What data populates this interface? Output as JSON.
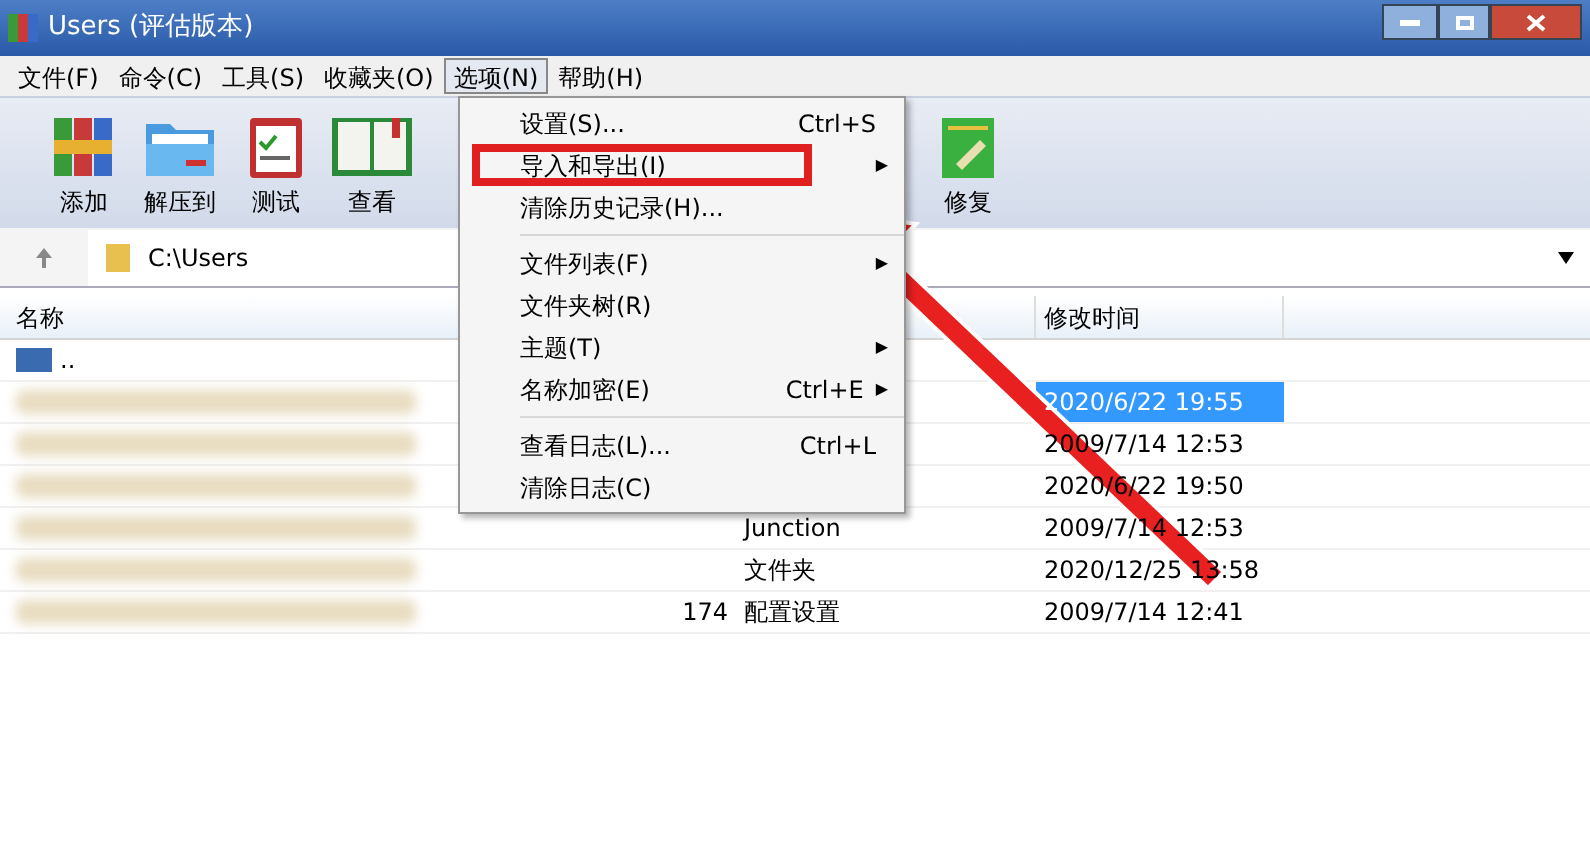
{
  "window": {
    "title": "Users (评估版本)"
  },
  "menubar": [
    {
      "label": "文件(F)",
      "selected": false
    },
    {
      "label": "命令(C)",
      "selected": false
    },
    {
      "label": "工具(S)",
      "selected": false
    },
    {
      "label": "收藏夹(O)",
      "selected": false
    },
    {
      "label": "选项(N)",
      "selected": true
    },
    {
      "label": "帮助(H)",
      "selected": false
    }
  ],
  "toolbar": [
    {
      "label": "添加",
      "kind": "add"
    },
    {
      "label": "解压到",
      "kind": "extract"
    },
    {
      "label": "测试",
      "kind": "test"
    },
    {
      "label": "查看",
      "kind": "view"
    },
    {
      "label": "修复",
      "kind": "repair"
    }
  ],
  "address": {
    "path": "C:\\Users"
  },
  "table": {
    "columns": [
      "名称",
      "修改时间"
    ],
    "rows": [
      {
        "name": "..",
        "selected": false
      },
      {
        "modified": "2020/6/22 19:55",
        "selected": true
      },
      {
        "modified": "2009/7/14 12:53",
        "selected": false
      },
      {
        "modified": "2020/6/22 19:50",
        "selected": false
      },
      {
        "type": "Junction",
        "modified": "2009/7/14 12:53",
        "selected": false
      },
      {
        "type": "文件夹",
        "modified": "2020/12/25 13:58",
        "selected": false
      },
      {
        "size": "174",
        "type": "配置设置",
        "modified": "2009/7/14 12:41",
        "selected": false
      }
    ]
  },
  "dropdown_menu": {
    "groups": [
      [
        {
          "label": "设置(S)...",
          "shortcut": "Ctrl+S",
          "highlighted": false
        },
        {
          "label": "导入和导出(I)",
          "arrow": "▶",
          "highlighted": true
        },
        {
          "label": "清除历史记录(H)...",
          "highlighted": false
        }
      ],
      [
        {
          "label": "文件列表(F)",
          "arrow": "▶",
          "highlighted": false
        },
        {
          "label": "文件夹树(R)",
          "highlighted": false
        },
        {
          "label": "主题(T)",
          "arrow": "▶",
          "highlighted": false
        },
        {
          "label": "名称加密(E)",
          "shortcut": "Ctrl+E",
          "arrow": "▶",
          "highlighted": false
        }
      ],
      [
        {
          "label": "查看日志(L)...",
          "shortcut": "Ctrl+L",
          "highlighted": false
        },
        {
          "label": "清除日志(C)",
          "highlighted": false
        }
      ]
    ]
  }
}
